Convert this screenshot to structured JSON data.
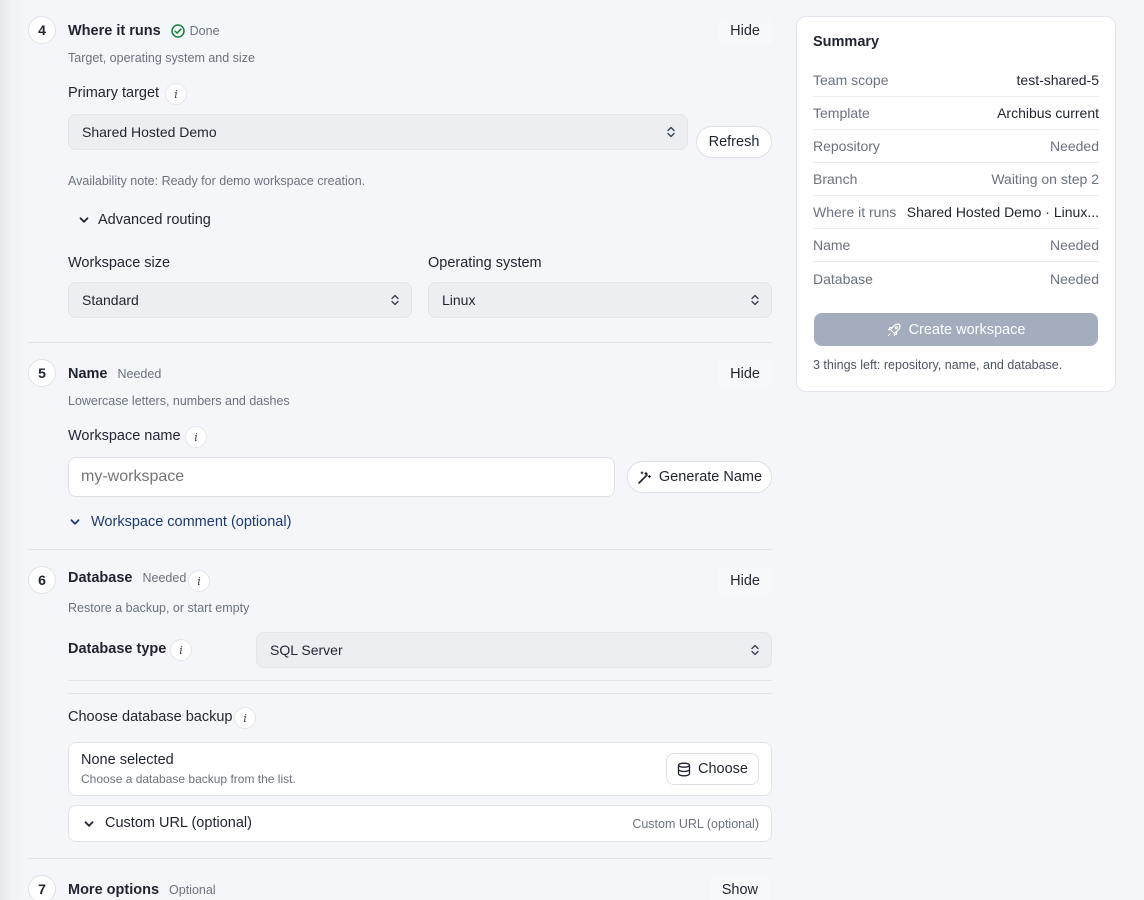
{
  "step4": {
    "number": "4",
    "title": "Where it runs",
    "status": "Done",
    "subtitle": "Target, operating system and size",
    "toggle": "Hide",
    "primary_target_label": "Primary target",
    "primary_target_value": "Shared Hosted Demo",
    "refresh_label": "Refresh",
    "availability_note": "Availability note: Ready for demo workspace creation.",
    "advanced_routing_label": "Advanced routing",
    "workspace_size_label": "Workspace size",
    "workspace_size_value": "Standard",
    "os_label": "Operating system",
    "os_value": "Linux"
  },
  "step5": {
    "number": "5",
    "title": "Name",
    "status": "Needed",
    "subtitle": "Lowercase letters, numbers and dashes",
    "toggle": "Hide",
    "workspace_name_label": "Workspace name",
    "workspace_name_placeholder": "my-workspace",
    "generate_label": "Generate Name",
    "comment_label": "Workspace comment (optional)"
  },
  "step6": {
    "number": "6",
    "title": "Database",
    "status": "Needed",
    "subtitle": "Restore a backup, or start empty",
    "toggle": "Hide",
    "db_type_label": "Database type",
    "db_type_value": "SQL Server",
    "backup_label": "Choose database backup",
    "backup_selected": "None selected",
    "backup_hint": "Choose a database backup from the list.",
    "choose_label": "Choose",
    "custom_url_label": "Custom URL (optional)",
    "custom_url_hint": "Custom URL (optional)"
  },
  "step7": {
    "number": "7",
    "title": "More options",
    "status": "Optional",
    "toggle": "Show"
  },
  "summary": {
    "title": "Summary",
    "rows": [
      {
        "key": "Team scope",
        "value": "test-shared-5"
      },
      {
        "key": "Template",
        "value": "Archibus current"
      },
      {
        "key": "Repository",
        "value": "Needed"
      },
      {
        "key": "Branch",
        "value": "Waiting on step 2"
      },
      {
        "key": "Where it runs",
        "value": "Shared Hosted Demo · Linux..."
      },
      {
        "key": "Name",
        "value": "Needed"
      },
      {
        "key": "Database",
        "value": "Needed"
      }
    ],
    "create_label": "Create workspace",
    "remaining_note": "3 things left: repository, name, and database."
  },
  "colors": {
    "accent_link": "#1e3a6e",
    "done_green": "#16803c",
    "create_disabled_bg": "#a3adbd"
  },
  "icons": [
    "check-circle-icon",
    "chevron-updown-icon",
    "chevron-down-icon",
    "wand-icon",
    "database-icon",
    "rocket-icon",
    "info-icon"
  ]
}
